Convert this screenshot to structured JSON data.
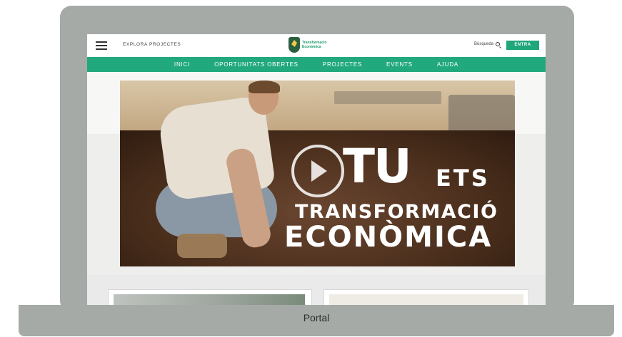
{
  "caption": "Portal",
  "header": {
    "explore_label": "EXPLORA PROJECTES",
    "logo_text_line1": "Transformació",
    "logo_text_line2": "Econòmica",
    "search_label": "Búsqueda",
    "login_label": "ENTRA"
  },
  "nav": {
    "items": [
      "INICI",
      "OPORTUNITATS OBERTES",
      "PROJECTES",
      "EVENTS",
      "AJUDA"
    ]
  },
  "hero": {
    "line1": "TU",
    "line1_suffix": "ETS",
    "line2": "TRANSFORMACIÓ",
    "line3": "ECONÒMICA"
  },
  "colors": {
    "accent": "#21a97d",
    "frame": "#a6aaa7"
  }
}
